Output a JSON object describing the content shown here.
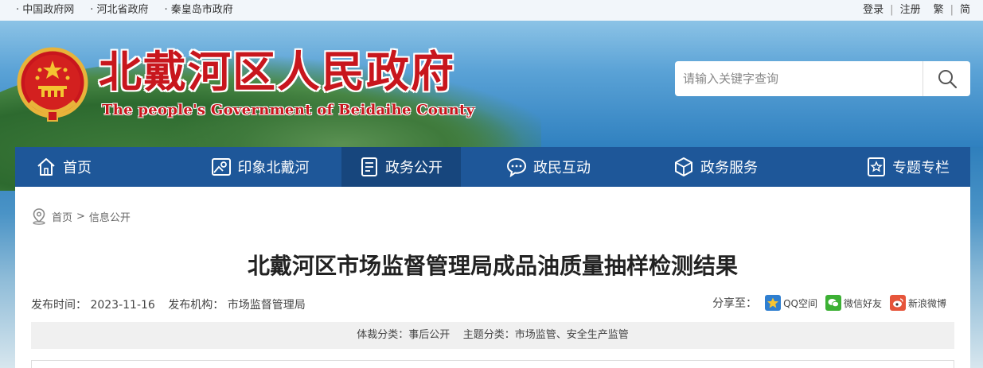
{
  "topbar": {
    "links": [
      "· 中国政府网",
      "· 河北省政府",
      "· 秦皇岛市政府"
    ],
    "login": "登录",
    "register": "注册",
    "traditional": "繁",
    "simplified": "简"
  },
  "header": {
    "title": "北戴河区人民政府",
    "subtitle": "The people's Government of Beidaihe County",
    "search_placeholder": "请输入关键字查询",
    "emblem_icon": "national-emblem-icon",
    "search_icon": "search-icon"
  },
  "nav": {
    "items": [
      {
        "label": "首页",
        "icon": "home-icon"
      },
      {
        "label": "印象北戴河",
        "icon": "map-icon"
      },
      {
        "label": "政务公开",
        "icon": "document-icon",
        "active": true
      },
      {
        "label": "政民互动",
        "icon": "chat-icon"
      },
      {
        "label": "政务服务",
        "icon": "cube-icon"
      },
      {
        "label": "专题专栏",
        "icon": "star-icon"
      }
    ]
  },
  "breadcrumb": {
    "home": "首页",
    "separator": ">",
    "current": "信息公开"
  },
  "article": {
    "title": "北戴河区市场监督管理局成品油质量抽样检测结果",
    "publish_time_label": "发布时间：",
    "publish_time": "2023-11-16",
    "publisher_label": "发布机构：",
    "publisher": "市场监督管理局",
    "share_label": "分享至：",
    "share": [
      {
        "label": "QQ空间",
        "icon": "qzone-icon",
        "color": "#2f7fd0"
      },
      {
        "label": "微信好友",
        "icon": "wechat-icon",
        "color": "#3cb034"
      },
      {
        "label": "新浪微博",
        "icon": "weibo-icon",
        "color": "#e6553b"
      }
    ],
    "classification": "体裁分类：事后公开    主题分类：市场监管、安全生产监管"
  },
  "colors": {
    "brand_red": "#c8161d",
    "nav_blue": "#1e5799",
    "nav_active": "#17467d"
  }
}
